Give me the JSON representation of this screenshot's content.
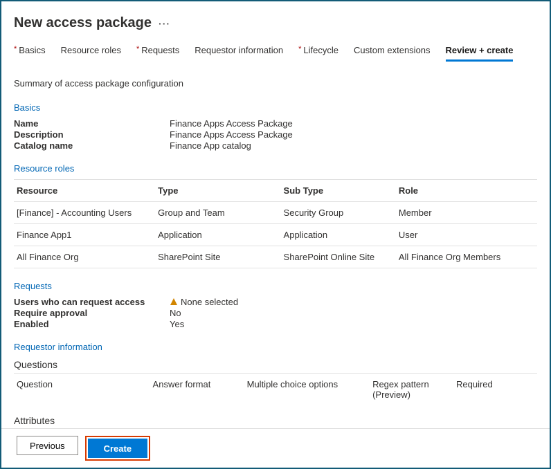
{
  "header": {
    "title": "New access package"
  },
  "tabs": {
    "basics": "Basics",
    "resource_roles": "Resource roles",
    "requests": "Requests",
    "requestor_info": "Requestor information",
    "lifecycle": "Lifecycle",
    "custom_ext": "Custom extensions",
    "review": "Review + create"
  },
  "summary": {
    "intro": "Summary of access package configuration",
    "basics_h": "Basics",
    "name_k": "Name",
    "name_v": "Finance Apps Access Package",
    "desc_k": "Description",
    "desc_v": "Finance Apps Access Package",
    "cat_k": "Catalog name",
    "cat_v": "Finance App catalog"
  },
  "resource_roles": {
    "h": "Resource roles",
    "cols": {
      "c1": "Resource",
      "c2": "Type",
      "c3": "Sub Type",
      "c4": "Role"
    },
    "rows": [
      {
        "c1": "[Finance] - Accounting Users",
        "c2": "Group and Team",
        "c3": "Security Group",
        "c4": "Member"
      },
      {
        "c1": "Finance App1",
        "c2": "Application",
        "c3": "Application",
        "c4": "User"
      },
      {
        "c1": "All Finance Org",
        "c2": "SharePoint Site",
        "c3": "SharePoint Online Site",
        "c4": "All Finance Org Members"
      }
    ]
  },
  "requests": {
    "h": "Requests",
    "users_k": "Users who can request access",
    "users_v": "None selected",
    "approval_k": "Require approval",
    "approval_v": "No",
    "enabled_k": "Enabled",
    "enabled_v": "Yes"
  },
  "requestor_info": {
    "h": "Requestor information",
    "questions_h": "Questions",
    "cols": {
      "c1": "Question",
      "c2": "Answer format",
      "c3": "Multiple choice options",
      "c4": "Regex pattern (Preview)",
      "c5": "Required"
    },
    "attributes_h": "Attributes"
  },
  "footer": {
    "previous": "Previous",
    "create": "Create"
  }
}
